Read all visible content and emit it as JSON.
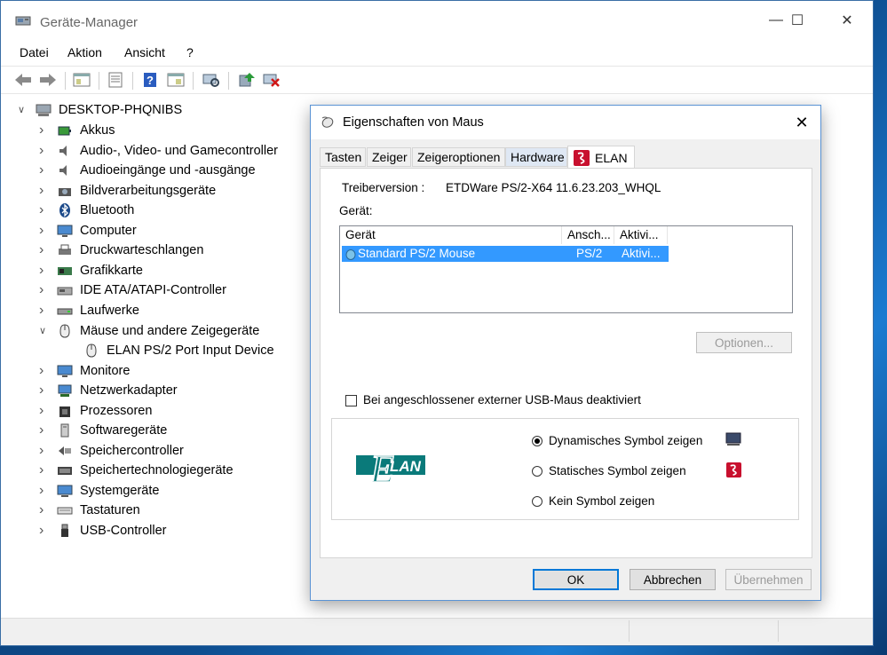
{
  "window": {
    "title": "Geräte-Manager",
    "buttons": {
      "minimize": "—",
      "maximize": "☐",
      "close": "✕"
    }
  },
  "menu": [
    "Datei",
    "Aktion",
    "Ansicht",
    "?"
  ],
  "tree": {
    "root": "DESKTOP-PHQNIBS",
    "items": [
      {
        "label": "Akkus",
        "icon": "battery-icon",
        "expanded": false
      },
      {
        "label": "Audio-, Video- und Gamecontroller",
        "icon": "speaker-icon",
        "expanded": false
      },
      {
        "label": "Audioeingänge und -ausgänge",
        "icon": "speaker-icon",
        "expanded": false
      },
      {
        "label": "Bildverarbeitungsgeräte",
        "icon": "camera-icon",
        "expanded": false
      },
      {
        "label": "Bluetooth",
        "icon": "bluetooth-icon",
        "expanded": false
      },
      {
        "label": "Computer",
        "icon": "monitor-icon",
        "expanded": false
      },
      {
        "label": "Druckwarteschlangen",
        "icon": "printer-icon",
        "expanded": false
      },
      {
        "label": "Grafikkarte",
        "icon": "graphics-card-icon",
        "expanded": false
      },
      {
        "label": "IDE ATA/ATAPI-Controller",
        "icon": "controller-icon",
        "expanded": false
      },
      {
        "label": "Laufwerke",
        "icon": "drive-icon",
        "expanded": false
      },
      {
        "label": "Mäuse und andere Zeigegeräte",
        "icon": "mouse-icon",
        "expanded": true
      },
      {
        "label": "ELAN PS/2 Port Input Device",
        "icon": "mouse-icon",
        "child": true
      },
      {
        "label": "Monitore",
        "icon": "monitor-icon",
        "expanded": false
      },
      {
        "label": "Netzwerkadapter",
        "icon": "network-icon",
        "expanded": false
      },
      {
        "label": "Prozessoren",
        "icon": "cpu-icon",
        "expanded": false
      },
      {
        "label": "Softwaregeräte",
        "icon": "software-device-icon",
        "expanded": false
      },
      {
        "label": "Speichercontroller",
        "icon": "storage-controller-icon",
        "expanded": false
      },
      {
        "label": "Speichertechnologiegeräte",
        "icon": "storage-tech-icon",
        "expanded": false
      },
      {
        "label": "Systemgeräte",
        "icon": "system-icon",
        "expanded": false
      },
      {
        "label": "Tastaturen",
        "icon": "keyboard-icon",
        "expanded": false
      },
      {
        "label": "USB-Controller",
        "icon": "usb-icon",
        "expanded": false
      }
    ]
  },
  "dialog": {
    "title": "Eigenschaften von Maus",
    "tabs": [
      "Tasten",
      "Zeiger",
      "Zeigeroptionen",
      "Hardware",
      "ELAN"
    ],
    "active_tab": "ELAN",
    "driver_label": "Treiberversion :",
    "driver_value": "ETDWare PS/2-X64 11.6.23.203_WHQL",
    "device_label": "Gerät:",
    "list": {
      "columns": [
        "Gerät",
        "Ansch...",
        "Aktivi..."
      ],
      "rows": [
        {
          "name": "Standard PS/2 Mouse",
          "port": "PS/2",
          "active": "Aktivi..."
        }
      ]
    },
    "options_button": "Optionen...",
    "checkbox_label": "Bei angeschlossener externer USB-Maus deaktiviert",
    "checkbox_checked": false,
    "logo_text": "LAN",
    "logo_letter": "E",
    "radios": [
      {
        "label": "Dynamisches Symbol zeigen",
        "selected": true
      },
      {
        "label": "Statisches Symbol zeigen",
        "selected": false
      },
      {
        "label": "Kein Symbol zeigen",
        "selected": false
      }
    ],
    "buttons": {
      "ok": "OK",
      "cancel": "Abbrechen",
      "apply": "Übernehmen"
    }
  },
  "colors": {
    "accent": "#0078d7",
    "selection": "#3399ff",
    "elan_red": "#c8102e",
    "elan_teal": "#0a7a7a"
  }
}
